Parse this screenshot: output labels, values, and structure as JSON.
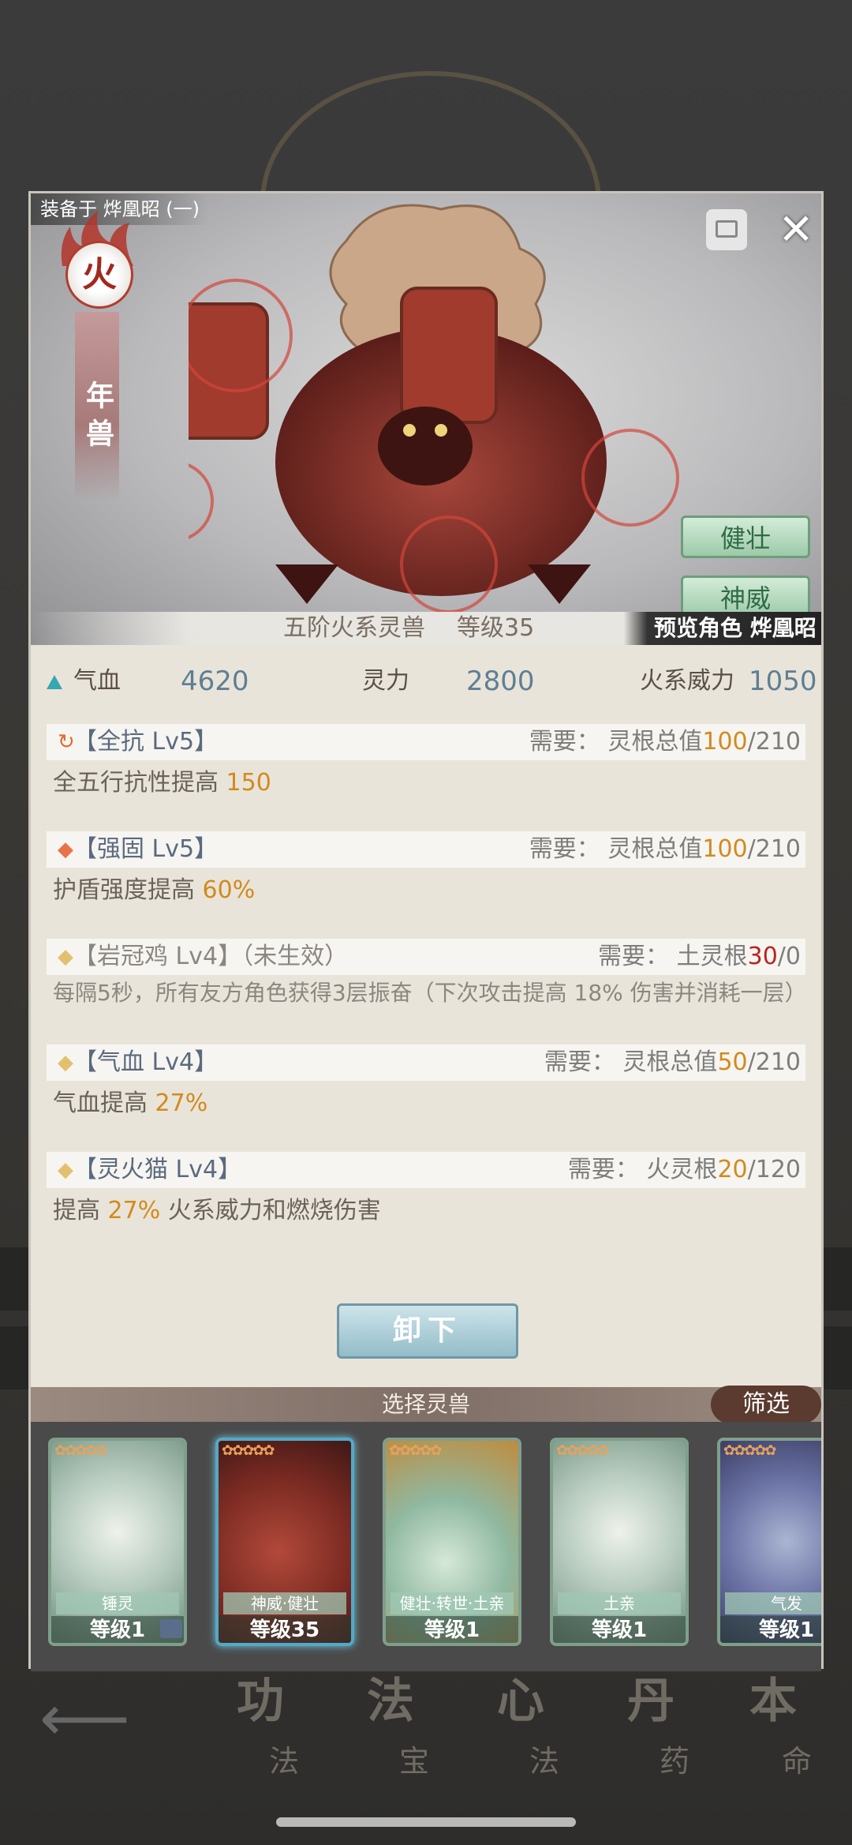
{
  "panel": {
    "equip_label": "装备于 烨凰昭 (一)",
    "element": "火",
    "beast_name": "年兽",
    "traits": [
      "健壮",
      "神威"
    ],
    "stage": "五阶火系灵兽",
    "level": "等级35",
    "preview": "预览角色 烨凰昭"
  },
  "stats": {
    "hp_label": "气血",
    "hp_value": "4620",
    "spirit_label": "灵力",
    "spirit_value": "2800",
    "fire_label": "火系威力",
    "fire_value": "1050"
  },
  "effects": [
    {
      "name": "【全抗 Lv5】",
      "req_prefix": "需要： 灵根总值",
      "req_have": "100",
      "req_total": "/210",
      "desc_prefix": "全五行抗性提高 ",
      "desc_value": "150",
      "desc_suffix": ""
    },
    {
      "name": "【强固 Lv5】",
      "req_prefix": "需要： 灵根总值",
      "req_have": "100",
      "req_total": "/210",
      "desc_prefix": "护盾强度提高 ",
      "desc_value": "60%",
      "desc_suffix": ""
    },
    {
      "name": "【岩冠鸡 Lv4】（未生效）",
      "req_prefix": "需要： 土灵根",
      "req_have": "30",
      "req_total": "/0",
      "desc_prefix": "每隔5秒，所有友方角色获得3层振奋（下次攻击提高 18% 伤害并消耗一层）",
      "desc_value": "",
      "desc_suffix": ""
    },
    {
      "name": "【气血 Lv4】",
      "req_prefix": "需要： 灵根总值",
      "req_have": "50",
      "req_total": "/210",
      "desc_prefix": "气血提高 ",
      "desc_value": "27%",
      "desc_suffix": ""
    },
    {
      "name": "【灵火猫 Lv4】",
      "req_prefix": "需要： 火灵根",
      "req_have": "20",
      "req_total": "/120",
      "desc_prefix": "提高 ",
      "desc_value": "27%",
      "desc_suffix": " 火系威力和燃烧伤害"
    }
  ],
  "unequip_label": "卸下",
  "select_title": "选择灵兽",
  "filter_label": "筛选",
  "cards": [
    {
      "trait": "锤灵",
      "level": "等级1"
    },
    {
      "trait": "神威·健壮",
      "level": "等级35"
    },
    {
      "trait": "健壮·转世·土亲",
      "level": "等级1"
    },
    {
      "trait": "土亲",
      "level": "等级1"
    },
    {
      "trait": "气发",
      "level": "等级1"
    }
  ],
  "nav": [
    {
      "big": "功",
      "small": "法"
    },
    {
      "big": "法",
      "small": "宝"
    },
    {
      "big": "心",
      "small": "法"
    },
    {
      "big": "丹",
      "small": "药"
    },
    {
      "big": "本",
      "small": "命"
    }
  ],
  "colors": {
    "highlight": "#d28a1d",
    "unmet": "#b8261d",
    "stat_value": "#5e7f93"
  }
}
